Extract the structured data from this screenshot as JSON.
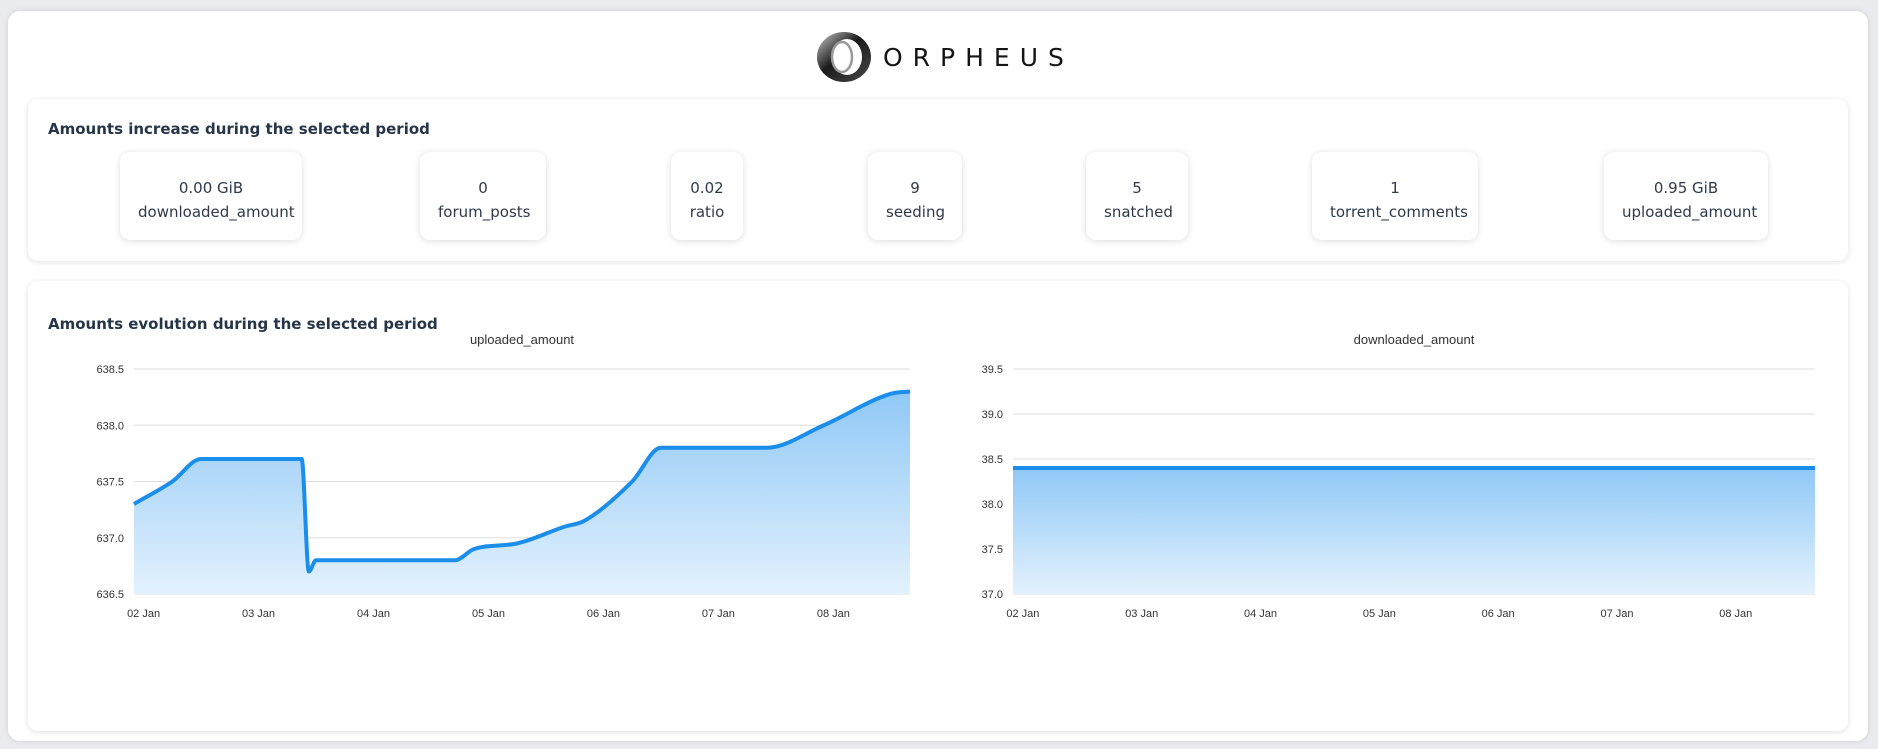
{
  "brand": {
    "name": "ORPHEUS"
  },
  "summary": {
    "title": "Amounts increase during the selected period",
    "stats": [
      {
        "value": "0.00 GiB",
        "label": "downloaded_amount"
      },
      {
        "value": "0",
        "label": "forum_posts"
      },
      {
        "value": "0.02",
        "label": "ratio"
      },
      {
        "value": "9",
        "label": "seeding"
      },
      {
        "value": "5",
        "label": "snatched"
      },
      {
        "value": "1",
        "label": "torrent_comments"
      },
      {
        "value": "0.95 GiB",
        "label": "uploaded_amount"
      }
    ]
  },
  "evolution": {
    "title": "Amounts evolution during the selected period"
  },
  "colors": {
    "line": "#1a8eea",
    "area_top": "#8fc8f6",
    "area_bottom": "#e3f1fd",
    "grid": "#dddddd"
  },
  "chart_data": [
    {
      "type": "area",
      "title": "uploaded_amount",
      "x": [
        "2024-01-01T22:00",
        "2024-01-02T06:00",
        "2024-01-02T12:00",
        "2024-01-03T00:00",
        "2024-01-03T09:00",
        "2024-01-03T10:30",
        "2024-01-03T12:00",
        "2024-01-04T00:00",
        "2024-01-04T12:00",
        "2024-01-04T17:00",
        "2024-01-04T21:00",
        "2024-01-05T06:00",
        "2024-01-05T16:00",
        "2024-01-05T20:00",
        "2024-01-06T06:00",
        "2024-01-06T12:00",
        "2024-01-07T00:00",
        "2024-01-07T10:00",
        "2024-01-07T22:00",
        "2024-01-08T12:00",
        "2024-01-08T16:00"
      ],
      "y": [
        637.3,
        637.5,
        637.7,
        637.7,
        637.7,
        636.7,
        636.8,
        636.8,
        636.8,
        636.8,
        636.9,
        636.95,
        637.1,
        637.15,
        637.5,
        637.8,
        637.8,
        637.8,
        638.0,
        638.28,
        638.3
      ],
      "xticks": [
        "02 Jan",
        "03 Jan",
        "04 Jan",
        "05 Jan",
        "06 Jan",
        "07 Jan",
        "08 Jan"
      ],
      "yticks": [
        "636.5",
        "637.0",
        "637.5",
        "638.0",
        "638.5"
      ],
      "ylim": [
        636.5,
        638.5
      ],
      "grid": true
    },
    {
      "type": "area",
      "title": "downloaded_amount",
      "x": [
        "2024-01-01T22:00",
        "2024-01-08T16:00"
      ],
      "y": [
        38.4,
        38.4
      ],
      "xticks": [
        "02 Jan",
        "03 Jan",
        "04 Jan",
        "05 Jan",
        "06 Jan",
        "07 Jan",
        "08 Jan"
      ],
      "yticks": [
        "37.0",
        "37.5",
        "38.0",
        "38.5",
        "39.0",
        "39.5"
      ],
      "ylim": [
        37.0,
        39.5
      ],
      "grid": true
    }
  ]
}
